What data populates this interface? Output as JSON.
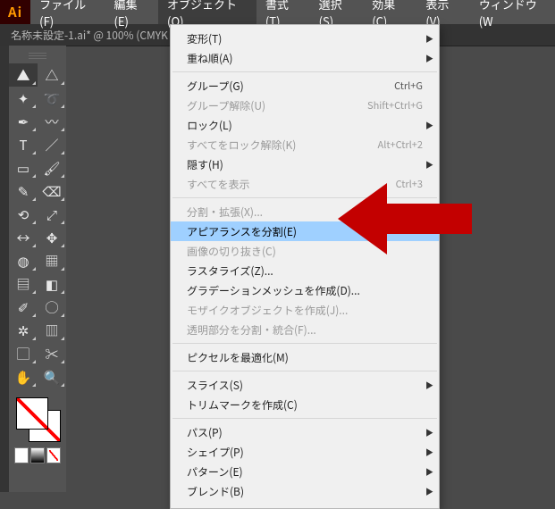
{
  "app": {
    "logo_text": "Ai"
  },
  "menubar": {
    "items": [
      {
        "label": "ファイル(F)"
      },
      {
        "label": "編集(E)"
      },
      {
        "label": "オブジェクト(O)"
      },
      {
        "label": "書式(T)"
      },
      {
        "label": "選択(S)"
      },
      {
        "label": "効果(C)"
      },
      {
        "label": "表示(V)"
      },
      {
        "label": "ウィンドウ(W"
      }
    ],
    "open_index": 2
  },
  "doc_tab": {
    "title": "名称未設定-1.ai* @ 100% (CMYK"
  },
  "object_menu": [
    {
      "label": "変形(T)",
      "submenu": true
    },
    {
      "label": "重ね順(A)",
      "submenu": true
    },
    {
      "sep": true
    },
    {
      "label": "グループ(G)",
      "shortcut": "Ctrl+G"
    },
    {
      "label": "グループ解除(U)",
      "shortcut": "Shift+Ctrl+G",
      "disabled": true
    },
    {
      "label": "ロック(L)",
      "submenu": true
    },
    {
      "label": "すべてをロック解除(K)",
      "shortcut": "Alt+Ctrl+2",
      "disabled": true
    },
    {
      "label": "隠す(H)",
      "submenu": true
    },
    {
      "label": "すべてを表示",
      "shortcut": "Ctrl+3",
      "disabled": true
    },
    {
      "sep": true
    },
    {
      "label": "分割・拡張(X)...",
      "disabled": true
    },
    {
      "label": "アピアランスを分割(E)",
      "selected": true
    },
    {
      "label": "画像の切り抜き(C)",
      "disabled": true
    },
    {
      "label": "ラスタライズ(Z)..."
    },
    {
      "label": "グラデーションメッシュを作成(D)..."
    },
    {
      "label": "モザイクオブジェクトを作成(J)...",
      "disabled": true
    },
    {
      "label": "透明部分を分割・統合(F)...",
      "disabled": true
    },
    {
      "sep": true
    },
    {
      "label": "ピクセルを最適化(M)"
    },
    {
      "sep": true
    },
    {
      "label": "スライス(S)",
      "submenu": true
    },
    {
      "label": "トリムマークを作成(C)"
    },
    {
      "sep": true
    },
    {
      "label": "パス(P)",
      "submenu": true
    },
    {
      "label": "シェイプ(P)",
      "submenu": true
    },
    {
      "label": "パターン(E)",
      "submenu": true
    },
    {
      "label": "ブレンド(B)",
      "submenu": true
    }
  ],
  "tools": {
    "rows": [
      [
        "selection",
        "direct-selection"
      ],
      [
        "magic-wand",
        "lasso"
      ],
      [
        "pen",
        "curvature"
      ],
      [
        "type",
        "line-segment"
      ],
      [
        "rectangle",
        "paintbrush"
      ],
      [
        "shaper",
        "eraser"
      ],
      [
        "rotate",
        "scale"
      ],
      [
        "width",
        "free-transform"
      ],
      [
        "shape-builder",
        "perspective"
      ],
      [
        "mesh",
        "gradient"
      ],
      [
        "eyedropper",
        "blend"
      ],
      [
        "symbol-sprayer",
        "column-graph"
      ],
      [
        "artboard",
        "slice"
      ],
      [
        "hand",
        "zoom"
      ]
    ],
    "icons": {
      "selection": "▲",
      "direct-selection": "△",
      "magic-wand": "✦",
      "lasso": "➰",
      "pen": "✒",
      "curvature": "〰",
      "type": "T",
      "line-segment": "／",
      "rectangle": "▭",
      "paintbrush": "🖌",
      "shaper": "✎",
      "eraser": "⌫",
      "rotate": "⟲",
      "scale": "⤢",
      "width": "↔",
      "free-transform": "✥",
      "shape-builder": "◍",
      "perspective": "▦",
      "mesh": "▤",
      "gradient": "◧",
      "eyedropper": "✐",
      "blend": "◯",
      "symbol-sprayer": "✲",
      "column-graph": "▥",
      "artboard": "▢",
      "slice": "✂",
      "hand": "✋",
      "zoom": "🔍"
    }
  }
}
